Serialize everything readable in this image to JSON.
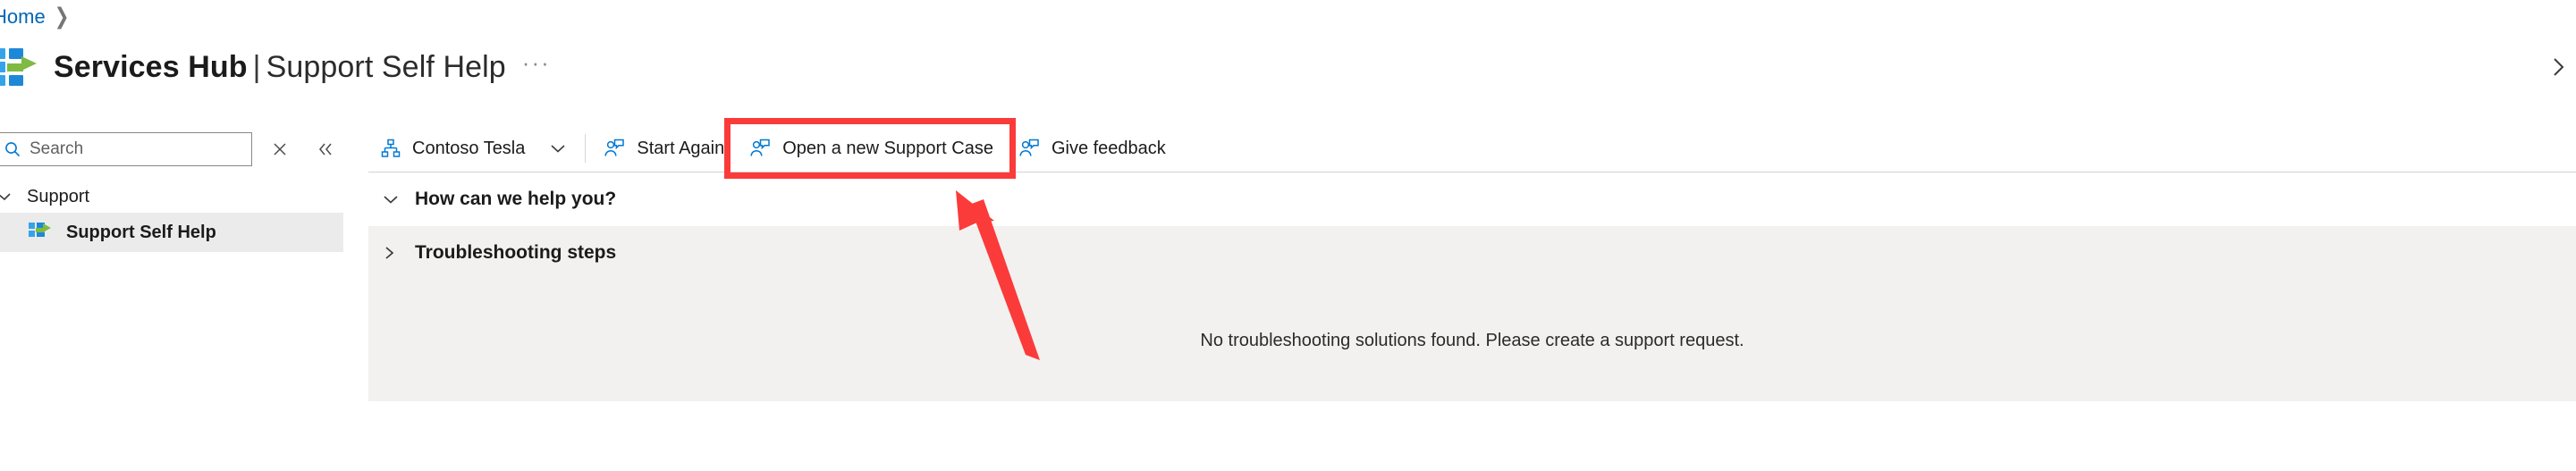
{
  "breadcrumb": {
    "items": [
      {
        "label": "Home",
        "icon": "chevron-right-icon"
      }
    ]
  },
  "header": {
    "logo_icon": "services-hub-logo-icon",
    "title_bold": "Services Hub",
    "title_separator": "|",
    "title_light": "Support Self Help",
    "overflow_label": "···",
    "edge_chevron_icon": "chevron-right-icon"
  },
  "sidebar": {
    "search": {
      "icon": "search-icon",
      "placeholder": "Search",
      "value": "",
      "clear_icon": "close-icon",
      "clear_label": "×"
    },
    "collapse_icon": "double-chevron-left-icon",
    "groups": [
      {
        "label": "Support",
        "expanded": true,
        "chevron_icon": "chevron-down-icon",
        "items": [
          {
            "label": "Support Self Help",
            "icon": "services-hub-logo-icon",
            "selected": true
          }
        ]
      }
    ]
  },
  "commandbar": {
    "items": [
      {
        "label": "Contoso Tesla",
        "icon": "org-hierarchy-icon",
        "has_chevron": true,
        "chevron_icon": "chevron-down-icon",
        "highlighted": false
      },
      {
        "label": "Start Again",
        "icon": "support-person-icon",
        "has_chevron": false,
        "highlighted": false
      },
      {
        "label": "Open a new Support Case",
        "icon": "support-person-icon",
        "has_chevron": false,
        "highlighted": true
      },
      {
        "label": "Give feedback",
        "icon": "support-person-icon",
        "has_chevron": false,
        "highlighted": false
      }
    ]
  },
  "main": {
    "sections": [
      {
        "label": "How can we help you?",
        "expanded": true,
        "chevron_icon": "chevron-down-icon"
      },
      {
        "label": "Troubleshooting steps",
        "expanded": false,
        "chevron_icon": "chevron-right-icon"
      }
    ],
    "empty_message": "No troubleshooting solutions found. Please create a support request."
  },
  "annotation": {
    "highlight_color": "#fb3b39",
    "box_target": "Open a new Support Case",
    "arrow_target": "Open a new Support Case"
  },
  "colors": {
    "link": "#0067b8",
    "accent_blue": "#0078d4",
    "panel_gray": "#f2f1f0",
    "selected_gray": "#ebebeb",
    "annotation_red": "#fb3b39",
    "logo_green": "#7fba42",
    "logo_blue": "#2f9be5"
  }
}
